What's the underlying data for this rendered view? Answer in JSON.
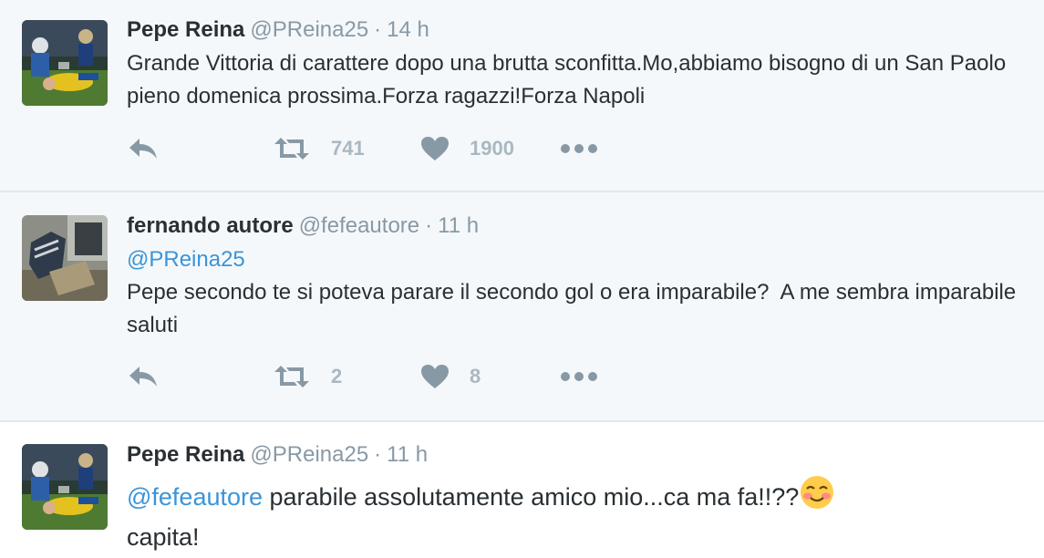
{
  "colors": {
    "background_read": "#f5f8fa",
    "background_new": "#ffffff",
    "text": "#292f33",
    "muted": "#8899a6",
    "mention": "#3b94d9"
  },
  "tweets": [
    {
      "author": "Pepe Reina",
      "handle": "@PReina25",
      "separator": "·",
      "time": "14 h",
      "text": "Grande Vittoria di carattere dopo una brutta sconfitta.Mo,abbiamo bisogno di un San Paolo pieno domenica prossima.Forza ragazzi!Forza Napoli",
      "retweets": "741",
      "likes": "1900",
      "icons": [
        "reply-icon",
        "retweet-icon",
        "heart-icon",
        "more-icon"
      ]
    },
    {
      "author": "fernando autore",
      "handle": "@fefeautore",
      "separator": "·",
      "time": "11 h",
      "mention": "@PReina25",
      "text": "Pepe secondo te si poteva parare il secondo gol o era imparabile?  A me sembra imparabile saluti",
      "retweets": "2",
      "likes": "8",
      "icons": [
        "reply-icon",
        "retweet-icon",
        "heart-icon",
        "more-icon"
      ]
    },
    {
      "author": "Pepe Reina",
      "handle": "@PReina25",
      "separator": "·",
      "time": "11 h",
      "mention": "@fefeautore",
      "text_a": " parabile assolutamente amico mio...ca ma fa!!??",
      "emoji": "smiling-blush-emoji",
      "text_b": "capita!"
    }
  ]
}
